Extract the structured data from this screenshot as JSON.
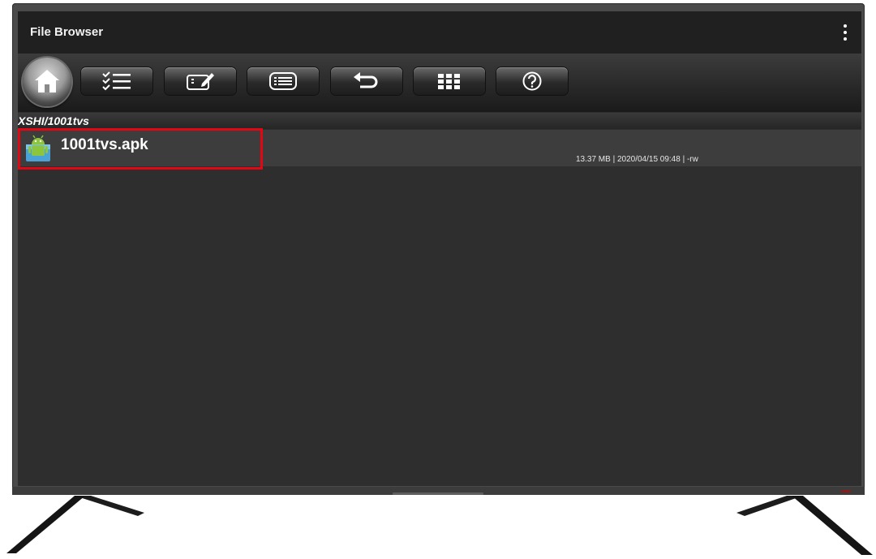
{
  "app": {
    "title": "File Browser",
    "menu_icon": "more-vert-icon"
  },
  "toolbar": {
    "buttons": [
      {
        "name": "home",
        "icon": "home-icon"
      },
      {
        "name": "multi-select",
        "icon": "checklist-icon"
      },
      {
        "name": "rename",
        "icon": "edit-icon"
      },
      {
        "name": "list-view",
        "icon": "list-icon"
      },
      {
        "name": "back",
        "icon": "undo-arrow-icon"
      },
      {
        "name": "grid-view",
        "icon": "grid-icon"
      },
      {
        "name": "help",
        "icon": "help-icon"
      }
    ]
  },
  "path": "XSHI/1001tvs",
  "files": [
    {
      "name": "1001tvs.apk",
      "icon": "android-apk-icon",
      "meta": "13.37 MB | 2020/04/15 09:48 | -rw",
      "highlighted": true
    }
  ],
  "colors": {
    "highlight": "#e30613",
    "screen_bg": "#2e2e2e"
  }
}
